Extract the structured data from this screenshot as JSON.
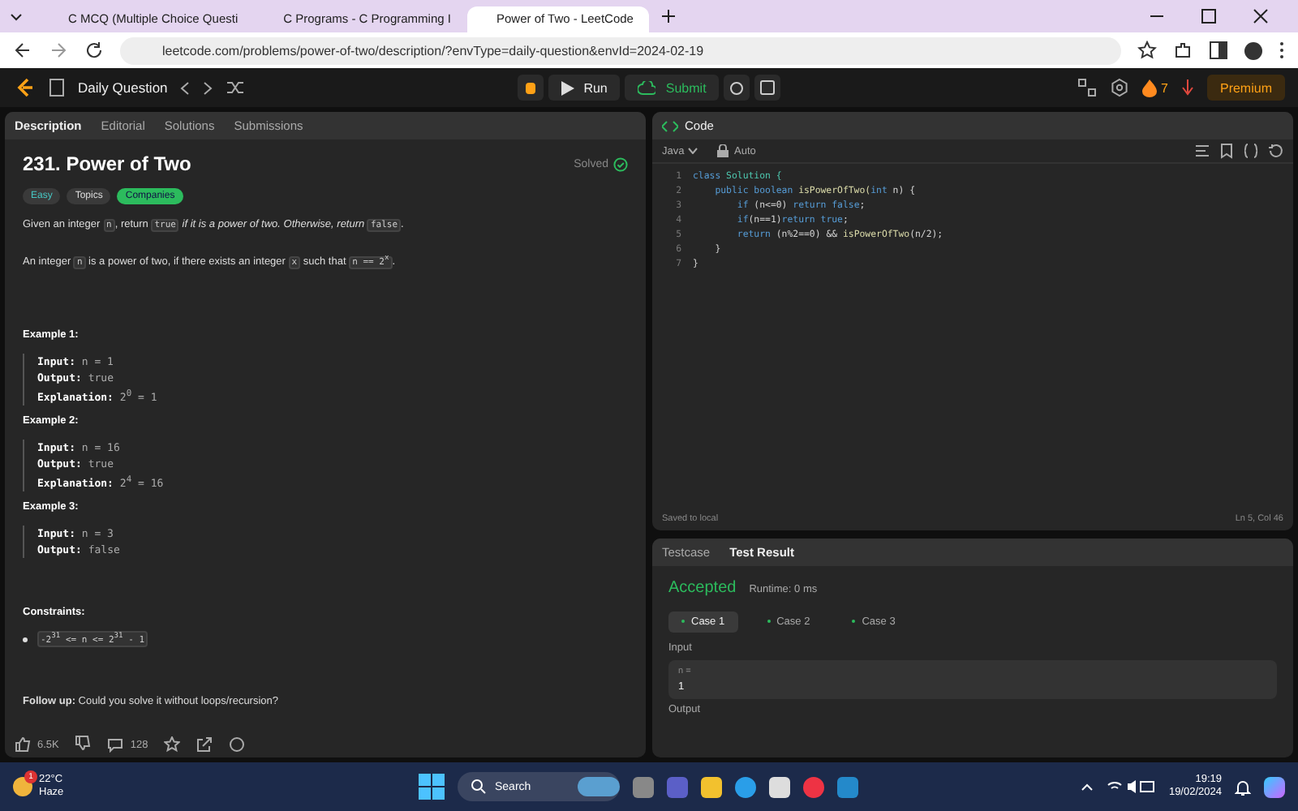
{
  "browser": {
    "tabs": [
      {
        "title": "C MCQ (Multiple Choice Questi",
        "selected": false
      },
      {
        "title": "C Programs - C Programming I",
        "selected": false
      },
      {
        "title": "Power of Two - LeetCode",
        "selected": true
      }
    ],
    "url": "leetcode.com/problems/power-of-two/description/?envType=daily-question&envId=2024-02-19"
  },
  "topbar": {
    "title": "Daily Question",
    "run": "Run",
    "submit": "Submit",
    "streak": "7",
    "premium": "Premium"
  },
  "left_tabs": [
    {
      "label": "Description",
      "selected": true
    },
    {
      "label": "Editorial",
      "selected": false
    },
    {
      "label": "Solutions",
      "selected": false
    },
    {
      "label": "Submissions",
      "selected": false
    }
  ],
  "problem": {
    "title": "231. Power of Two",
    "status": "Solved",
    "tags": [
      {
        "label": "Easy",
        "kind": "difficulty"
      },
      {
        "label": "Topics",
        "kind": "topics"
      },
      {
        "label": "Companies",
        "kind": "companies"
      }
    ],
    "paragraphs": [
      [
        {
          "t": "Given an integer ",
          "kind": "text"
        },
        {
          "t": "n",
          "kind": "code"
        },
        {
          "t": ", return ",
          "kind": "text"
        },
        {
          "t": "true",
          "kind": "code"
        },
        {
          "t": " if it is a power of two. Otherwise, return ",
          "kind": "italic"
        },
        {
          "t": "false",
          "kind": "code"
        },
        {
          "t": ".",
          "kind": "text"
        }
      ],
      [
        {
          "t": "An integer ",
          "kind": "text"
        },
        {
          "t": "n",
          "kind": "code"
        },
        {
          "t": " is a power of two, if there exists an integer ",
          "kind": "text"
        },
        {
          "t": "x",
          "kind": "code"
        },
        {
          "t": " such that ",
          "kind": "text"
        },
        {
          "t": "n == 2$^{x}$",
          "kind": "code"
        },
        {
          "t": ".",
          "kind": "text"
        }
      ]
    ],
    "examples": [
      {
        "title": "Example 1:",
        "lines": [
          {
            "label": "Input:",
            "value": "n = 1"
          },
          {
            "label": "Output:",
            "value": "true"
          },
          {
            "label": "Explanation:",
            "value": "2$^{0}$ = 1"
          }
        ]
      },
      {
        "title": "Example 2:",
        "lines": [
          {
            "label": "Input:",
            "value": "n = 16"
          },
          {
            "label": "Output:",
            "value": "true"
          },
          {
            "label": "Explanation:",
            "value": "2$^{4}$ = 16"
          }
        ]
      },
      {
        "title": "Example 3:",
        "lines": [
          {
            "label": "Input:",
            "value": "n = 3"
          },
          {
            "label": "Output:",
            "value": "false"
          }
        ]
      }
    ],
    "constraints_title": "Constraints:",
    "constraints": [
      "-2$^{31}$ <= n <= 2$^{31}$ - 1"
    ],
    "follow_up": "**Follow up:** Could you solve it without loops/recursion?",
    "likes": "6.5K",
    "comments": "128"
  },
  "editor": {
    "title": "Code",
    "language": "Java",
    "mode": "Auto",
    "lines": [
      [
        {
          "t": "class",
          "kind": "kw"
        },
        {
          "t": " Solution {",
          "kind": "type"
        }
      ],
      [
        {
          "t": "    public boolean",
          "kind": "kw"
        },
        {
          "t": " isPowerOfTwo(",
          "kind": "fn"
        },
        {
          "t": "int",
          "kind": "kw"
        },
        {
          "t": " n) {",
          "kind": "plain"
        }
      ],
      [
        {
          "t": "        if",
          "kind": "kw"
        },
        {
          "t": " (n<=0) ",
          "kind": "plain"
        },
        {
          "t": "return false",
          "kind": "kw"
        },
        {
          "t": ";",
          "kind": "plain"
        }
      ],
      [
        {
          "t": "        if",
          "kind": "kw"
        },
        {
          "t": "(n==1)",
          "kind": "plain"
        },
        {
          "t": "return true",
          "kind": "kw"
        },
        {
          "t": ";",
          "kind": "plain"
        }
      ],
      [
        {
          "t": "        return",
          "kind": "kw"
        },
        {
          "t": " (n%2==0) && ",
          "kind": "plain"
        },
        {
          "t": "isPowerOfTwo",
          "kind": "fn"
        },
        {
          "t": "(n/2);",
          "kind": "plain"
        }
      ],
      [
        {
          "t": "    }",
          "kind": "plain"
        }
      ],
      [
        {
          "t": "}",
          "kind": "plain"
        }
      ]
    ],
    "line_numbers": [
      "1",
      "2",
      "3",
      "4",
      "5",
      "6",
      "7"
    ],
    "saved": "Saved to local",
    "position": "Ln 5, Col 46"
  },
  "result": {
    "tabs": [
      {
        "label": "Testcase",
        "selected": false
      },
      {
        "label": "Test Result",
        "selected": true
      }
    ],
    "verdict": "Accepted",
    "runtime": "Runtime: 0 ms",
    "cases": [
      {
        "label": "Case 1",
        "selected": true
      },
      {
        "label": "Case 2",
        "selected": false
      },
      {
        "label": "Case 3",
        "selected": false
      }
    ],
    "input_label": "Input",
    "var": "n =",
    "value": "1",
    "output_label": "Output"
  },
  "taskbar": {
    "temp": "22°C",
    "weather": "Haze",
    "badge": "1",
    "search": "Search",
    "time": "19:19",
    "date": "19/02/2024"
  }
}
